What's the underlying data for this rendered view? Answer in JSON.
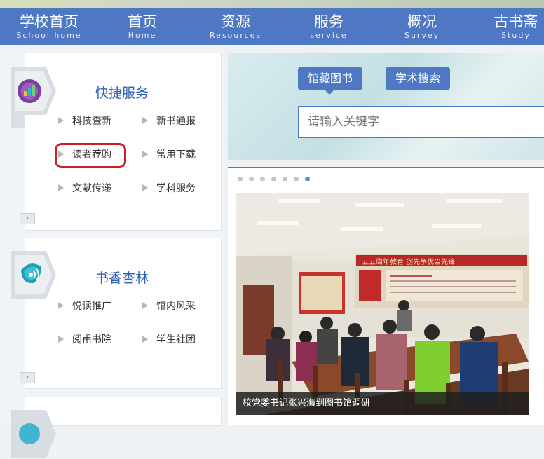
{
  "nav": [
    {
      "cn": "学校首页",
      "en": "School home"
    },
    {
      "cn": "首页",
      "en": "Home"
    },
    {
      "cn": "资源",
      "en": "Resources"
    },
    {
      "cn": "服务",
      "en": "service"
    },
    {
      "cn": "概况",
      "en": "Survey"
    },
    {
      "cn": "古书斋",
      "en": "Study"
    }
  ],
  "quick": {
    "title": "快捷服务",
    "links": [
      "科技查新",
      "新书通报",
      "读者荐购",
      "常用下载",
      "文献传递",
      "学科服务"
    ],
    "more": "›"
  },
  "books": {
    "title": "书香杏林",
    "links": [
      "悦读推广",
      "馆内风采",
      "阅甫书院",
      "学生社团"
    ],
    "more": "›"
  },
  "search": {
    "tabs": [
      "馆藏图书",
      "学术搜索"
    ],
    "placeholder": "请输入关键字"
  },
  "news": {
    "caption": "校党委书记张兴海到图书馆调研",
    "banner": "五五周年教育  创先争优当先锋"
  },
  "colors": {
    "nav": "#4f78c4",
    "highlight": "#cf1e26"
  }
}
